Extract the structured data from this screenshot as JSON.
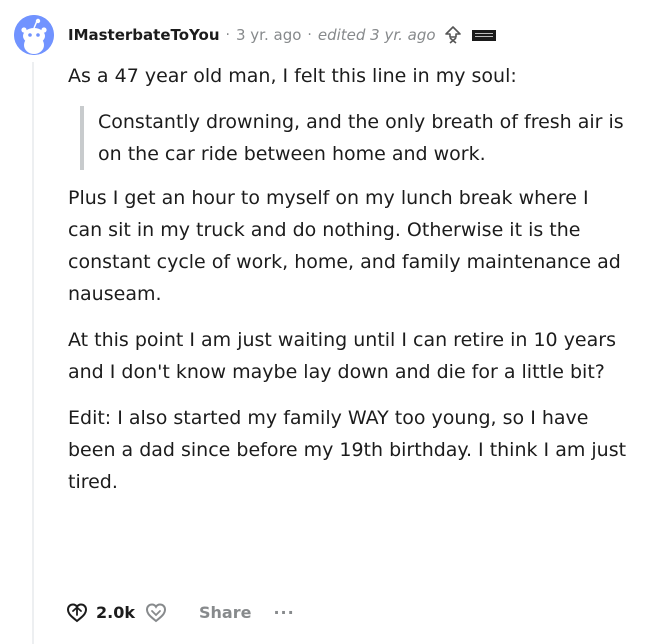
{
  "comment": {
    "username": "IMasterbateToYou",
    "separator": "·",
    "age": "3 yr. ago",
    "edited": "edited 3 yr. ago",
    "paragraph_1": "As a 47 year old man, I felt this line in my soul:",
    "quote": "Constantly drowning, and the only breath of fresh air is on the car ride between home and work.",
    "paragraph_2": "Plus I get an hour to myself on my lunch break where I can sit in my truck and do nothing. Otherwise it is the constant cycle of work, home, and family maintenance ad nauseam.",
    "paragraph_3": "At this point I am just waiting until I can retire in 10 years and I don't know maybe lay down and die for a little bit?",
    "paragraph_4": "Edit: I also started my family WAY too young, so I have been a dad since before my 19th birthday. I think I am just tired."
  },
  "actions": {
    "upvote_count": "2.0k",
    "share_label": "Share",
    "more_label": "···"
  },
  "colors": {
    "avatar": "#7193ff",
    "muted_text": "#878a8c",
    "thread_line": "#edeff1",
    "quote_bar": "#c8cbcd"
  },
  "icons": {
    "upvote": "upvote-icon",
    "downvote": "downvote-icon",
    "award": "award-icon"
  }
}
